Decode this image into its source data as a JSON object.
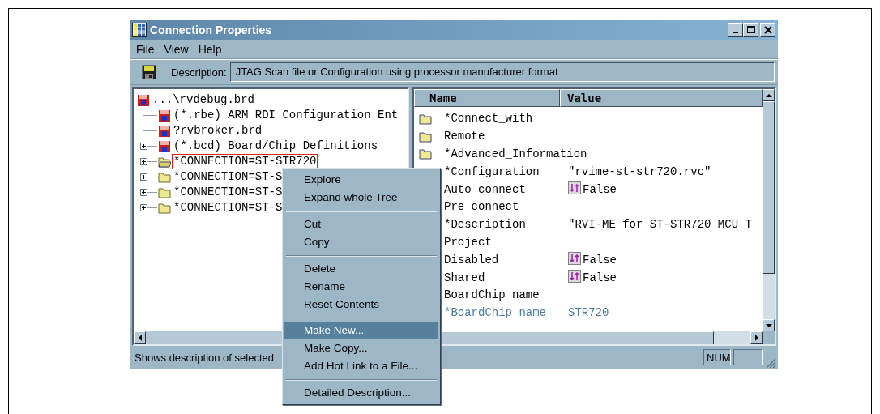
{
  "window": {
    "title": "Connection Properties"
  },
  "menu_bar": [
    "File",
    "View",
    "Help"
  ],
  "toolbar": {
    "description_label": "Description:",
    "description_value": "JTAG Scan file or Configuration using processor manufacturer format"
  },
  "tree": {
    "label": "...\\rvdebug.brd",
    "kind": "file",
    "children": [
      {
        "label": "(*.rbe) ARM RDI Configuration Ent",
        "kind": "file",
        "collapsed": false,
        "selected": false
      },
      {
        "label": "?rvbroker.brd",
        "kind": "file",
        "collapsed": false,
        "selected": false
      },
      {
        "label": "(*.bcd) Board/Chip Definitions",
        "kind": "file",
        "collapsed": true,
        "selected": false
      },
      {
        "label": "*CONNECTION=ST-STR720",
        "kind": "open-folder",
        "collapsed": true,
        "selected": true
      },
      {
        "label": "*CONNECTION=ST-S",
        "kind": "folder",
        "collapsed": true,
        "selected": false
      },
      {
        "label": "*CONNECTION=ST-S",
        "kind": "folder",
        "collapsed": true,
        "selected": false
      },
      {
        "label": "*CONNECTION=ST-S",
        "kind": "folder",
        "collapsed": true,
        "selected": false
      }
    ]
  },
  "properties": {
    "columns": [
      "Name",
      "Value"
    ],
    "rows": [
      {
        "name": "*Connect_with",
        "kind": "folder",
        "highlighted": false
      },
      {
        "name": "Remote",
        "kind": "folder",
        "highlighted": false
      },
      {
        "name": "*Advanced_Information",
        "kind": "folder",
        "highlighted": false
      },
      {
        "name": "*Configuration",
        "value": "\"rvime-st-str720.rvc\"",
        "kind": "item",
        "highlighted": false
      },
      {
        "name": "Auto connect",
        "value": "False",
        "kind": "toggle",
        "highlighted": false
      },
      {
        "name": "Pre connect",
        "kind": "item",
        "highlighted": false
      },
      {
        "name": "*Description",
        "value": "\"RVI-ME for ST-STR720 MCU T",
        "kind": "item",
        "highlighted": false
      },
      {
        "name": "Project",
        "kind": "item",
        "highlighted": false
      },
      {
        "name": "Disabled",
        "value": "False",
        "kind": "toggle",
        "highlighted": false
      },
      {
        "name": "Shared",
        "value": "False",
        "kind": "toggle",
        "highlighted": false
      },
      {
        "name": "BoardChip name",
        "kind": "item",
        "highlighted": false
      },
      {
        "name": "*BoardChip name",
        "value": "STR720",
        "kind": "item",
        "highlighted": true
      }
    ]
  },
  "status_bar": {
    "text": "Shows description of selected",
    "num": "NUM"
  },
  "context_menu": {
    "groups": [
      [
        {
          "label": "Explore",
          "selected": false
        },
        {
          "label": "Expand whole Tree",
          "selected": false
        }
      ],
      [
        {
          "label": "Cut",
          "selected": false
        },
        {
          "label": "Copy",
          "selected": false
        }
      ],
      [
        {
          "label": "Delete",
          "selected": false
        },
        {
          "label": "Rename",
          "selected": false
        },
        {
          "label": "Reset Contents",
          "selected": false
        }
      ],
      [
        {
          "label": "Make New...",
          "selected": true
        },
        {
          "label": "Make Copy...",
          "selected": false
        },
        {
          "label": "Add Hot Link to a File...",
          "selected": false
        }
      ],
      [
        {
          "label": "Detailed Description...",
          "selected": false
        }
      ]
    ]
  }
}
